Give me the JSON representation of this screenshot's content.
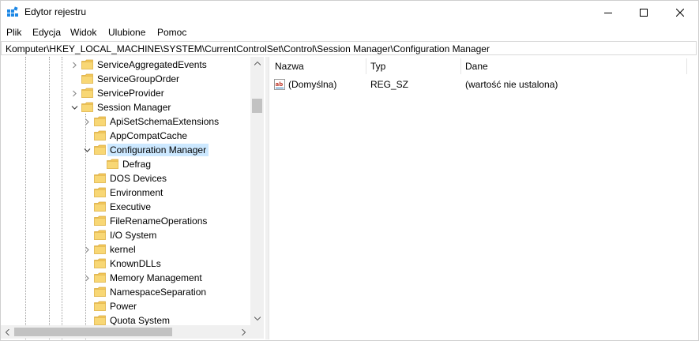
{
  "window": {
    "title": "Edytor rejestru"
  },
  "menu": [
    "Plik",
    "Edycja",
    "Widok",
    "Ulubione",
    "Pomoc"
  ],
  "address": {
    "path": "Komputer\\HKEY_LOCAL_MACHINE\\SYSTEM\\CurrentControlSet\\Control\\Session Manager\\Configuration Manager"
  },
  "tree": {
    "items": [
      {
        "label": "ServiceAggregatedEvents",
        "level": 0,
        "expander": "collapsed"
      },
      {
        "label": "ServiceGroupOrder",
        "level": 0,
        "expander": "none"
      },
      {
        "label": "ServiceProvider",
        "level": 0,
        "expander": "collapsed"
      },
      {
        "label": "Session Manager",
        "level": 0,
        "expander": "expanded"
      },
      {
        "label": "ApiSetSchemaExtensions",
        "level": 1,
        "expander": "collapsed"
      },
      {
        "label": "AppCompatCache",
        "level": 1,
        "expander": "none"
      },
      {
        "label": "Configuration Manager",
        "level": 1,
        "expander": "expanded",
        "selected": true
      },
      {
        "label": "Defrag",
        "level": 2,
        "expander": "none"
      },
      {
        "label": "DOS Devices",
        "level": 1,
        "expander": "none"
      },
      {
        "label": "Environment",
        "level": 1,
        "expander": "none"
      },
      {
        "label": "Executive",
        "level": 1,
        "expander": "none"
      },
      {
        "label": "FileRenameOperations",
        "level": 1,
        "expander": "none"
      },
      {
        "label": "I/O System",
        "level": 1,
        "expander": "none"
      },
      {
        "label": "kernel",
        "level": 1,
        "expander": "collapsed"
      },
      {
        "label": "KnownDLLs",
        "level": 1,
        "expander": "none"
      },
      {
        "label": "Memory Management",
        "level": 1,
        "expander": "collapsed"
      },
      {
        "label": "NamespaceSeparation",
        "level": 1,
        "expander": "none"
      },
      {
        "label": "Power",
        "level": 1,
        "expander": "none"
      },
      {
        "label": "Quota System",
        "level": 1,
        "expander": "none"
      }
    ]
  },
  "list": {
    "columns": [
      "Nazwa",
      "Typ",
      "Dane"
    ],
    "rows": [
      {
        "name": "(Domyślna)",
        "type": "REG_SZ",
        "data": "(wartość nie ustalona)",
        "icon": "string-value-icon"
      }
    ]
  },
  "colors": {
    "selection": "#cce8ff",
    "folder": "#f8d775",
    "app_icon": "#1e88e5"
  }
}
